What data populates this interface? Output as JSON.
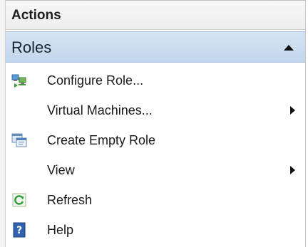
{
  "panel": {
    "title": "Actions"
  },
  "section": {
    "title": "Roles",
    "collapse_icon": "triangle-up-icon"
  },
  "items": [
    {
      "label": "Configure Role...",
      "icon": "configure-role-icon",
      "has_submenu": false
    },
    {
      "label": "Virtual Machines...",
      "icon": "",
      "has_submenu": true
    },
    {
      "label": "Create Empty Role",
      "icon": "create-empty-role-icon",
      "has_submenu": false
    },
    {
      "label": "View",
      "icon": "",
      "has_submenu": true
    },
    {
      "label": "Refresh",
      "icon": "refresh-icon",
      "has_submenu": false
    },
    {
      "label": "Help",
      "icon": "help-icon",
      "has_submenu": false
    }
  ],
  "colors": {
    "section_header": "#c9dbef",
    "help_icon": "#2f63b0",
    "refresh_icon": "#2e9a3c"
  }
}
